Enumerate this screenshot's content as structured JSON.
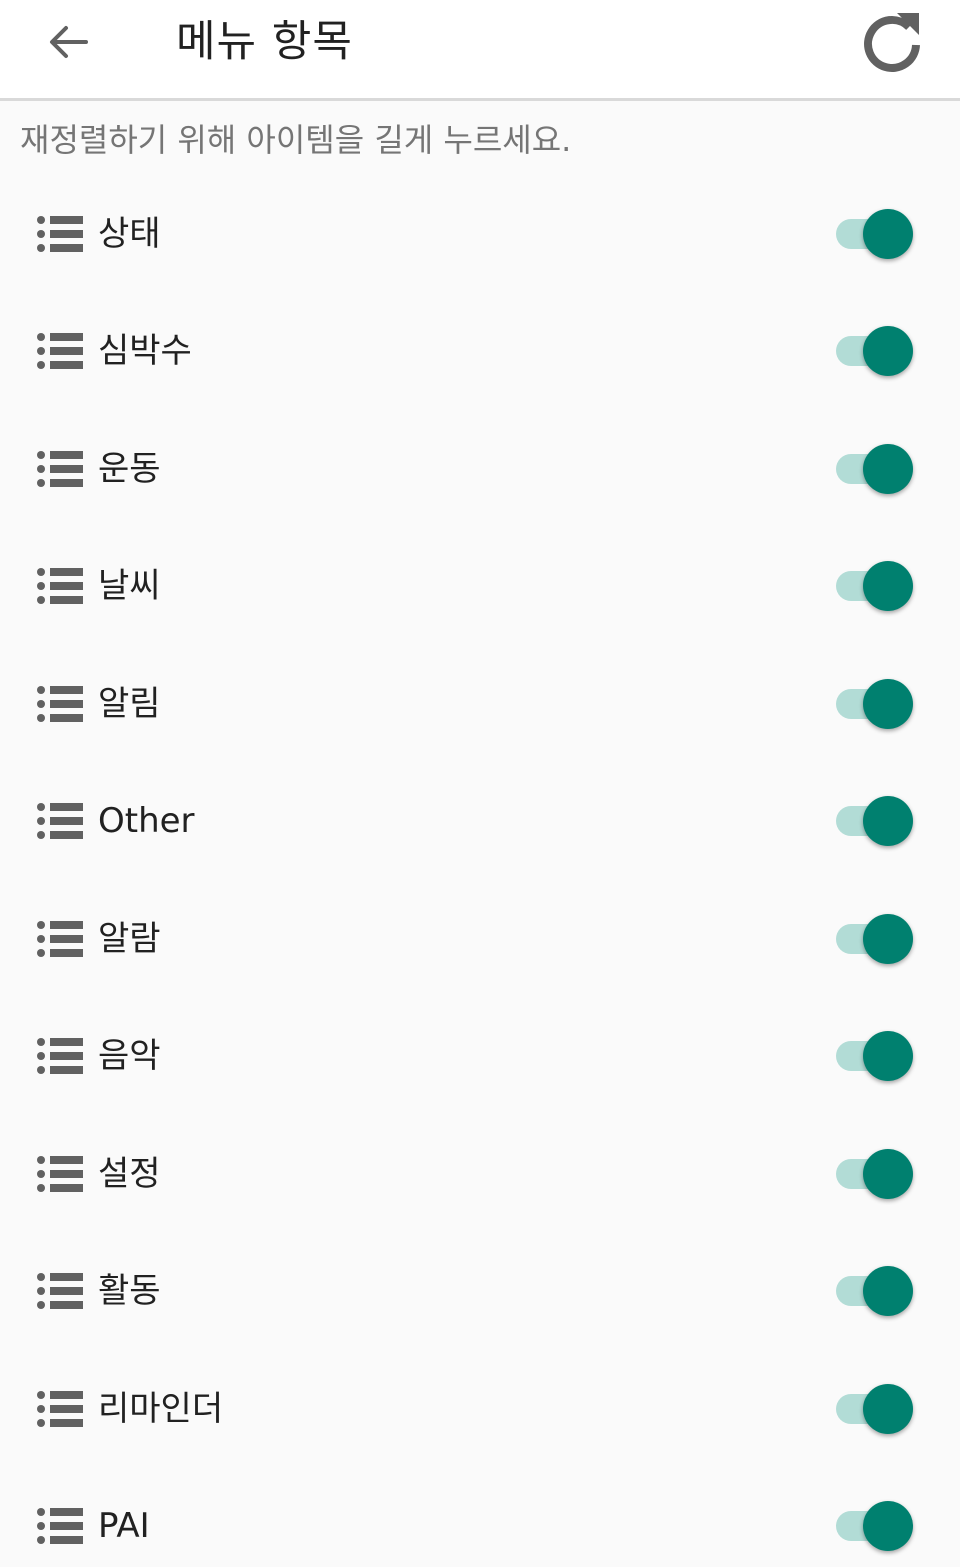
{
  "toolbar": {
    "title": "메뉴 항목",
    "back_icon": "arrow-left-icon",
    "reset_icon": "refresh-icon"
  },
  "hint": "재정렬하기 위해 아이템을 길게 누르세요.",
  "colors": {
    "accent": "#00806f",
    "track": "#b2dcd6",
    "icon": "#616161"
  },
  "items": [
    {
      "label": "상태",
      "enabled": true
    },
    {
      "label": "심박수",
      "enabled": true
    },
    {
      "label": "운동",
      "enabled": true
    },
    {
      "label": "날씨",
      "enabled": true
    },
    {
      "label": "알림",
      "enabled": true
    },
    {
      "label": "Other",
      "enabled": true
    },
    {
      "label": "알람",
      "enabled": true
    },
    {
      "label": "음악",
      "enabled": true
    },
    {
      "label": "설정",
      "enabled": true
    },
    {
      "label": "활동",
      "enabled": true
    },
    {
      "label": "리마인더",
      "enabled": true
    },
    {
      "label": "PAI",
      "enabled": true
    }
  ]
}
